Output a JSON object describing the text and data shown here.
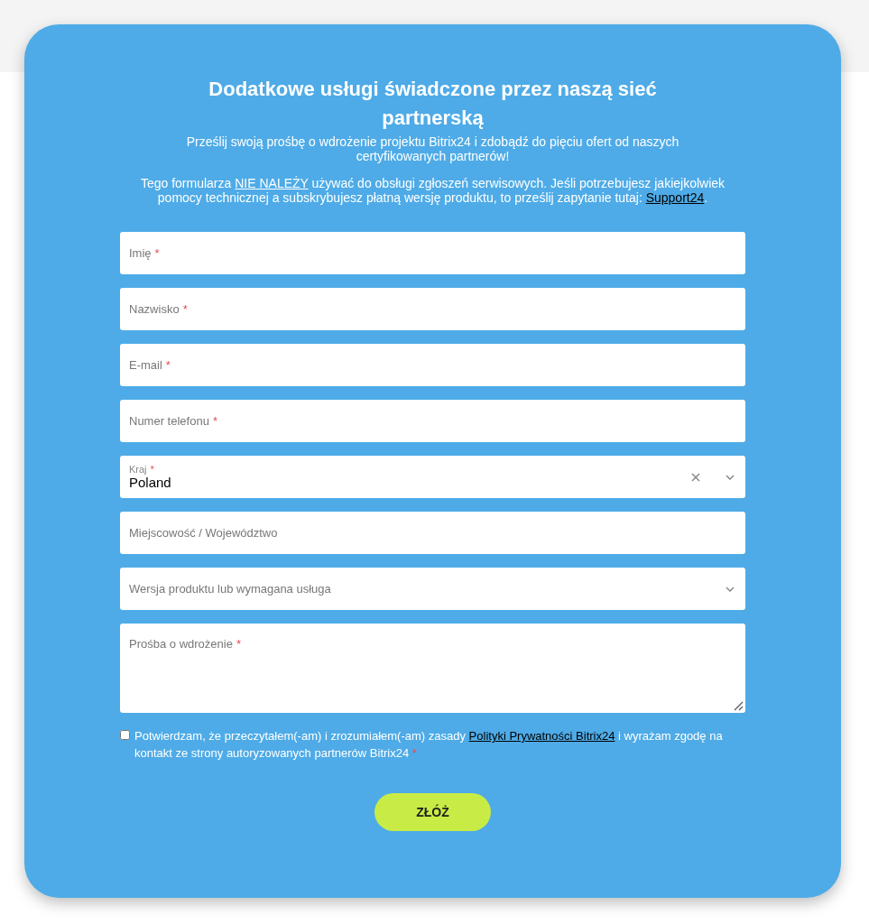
{
  "title": "Dodatkowe usługi świadczone przez naszą sieć partnerską",
  "intro": "Prześlij swoją prośbę o wdrożenie projektu Bitrix24 i zdobądź do pięciu ofert od naszych certyfikowanych partnerów!",
  "notice": [
    {
      "kind": "text",
      "text": "Tego formularza "
    },
    {
      "kind": "emphasis-link",
      "text": "NIE NALEŻY"
    },
    {
      "kind": "text",
      "text": " używać do obsługi zgłoszeń serwisowych. Jeśli potrzebujesz jakiejkolwiek pomocy technicznej a subskrybujesz płatną wersję produktu, to prześlij zapytanie tutaj: "
    },
    {
      "kind": "link",
      "text": "Support24"
    },
    {
      "kind": "text",
      "text": "."
    }
  ],
  "fields": [
    {
      "kind": "text",
      "placeholder": "Imię",
      "required_mark": "*"
    },
    {
      "kind": "text",
      "placeholder": "Nazwisko",
      "required_mark": "*"
    },
    {
      "kind": "text",
      "placeholder": "E-mail",
      "required_mark": "*"
    },
    {
      "kind": "text",
      "placeholder": "Numer telefonu",
      "required_mark": "*"
    },
    {
      "kind": "select",
      "label": "Kraj",
      "required_mark": "*",
      "value": "Poland",
      "clearable": true
    },
    {
      "kind": "text",
      "placeholder": "Miejscowość / Województwo"
    },
    {
      "kind": "select",
      "placeholder": "Wersja produktu lub wymagana usługa",
      "clearable": false
    },
    {
      "kind": "textarea",
      "placeholder": "Prośba o wdrożenie",
      "required_mark": "*"
    }
  ],
  "consent": {
    "checked": false,
    "parts": [
      {
        "kind": "text",
        "text": "Potwierdzam, że przeczytałem(-am) i zrozumiałem(-am) zasady "
      },
      {
        "kind": "link",
        "text": "Polityki Prywatności Bitrix24"
      },
      {
        "kind": "text",
        "text": " i wyrażam zgodę na kontakt ze strony autoryzowanych partnerów Bitrix24"
      }
    ],
    "required_mark": "*"
  },
  "submit": "ZŁÓŻ"
}
